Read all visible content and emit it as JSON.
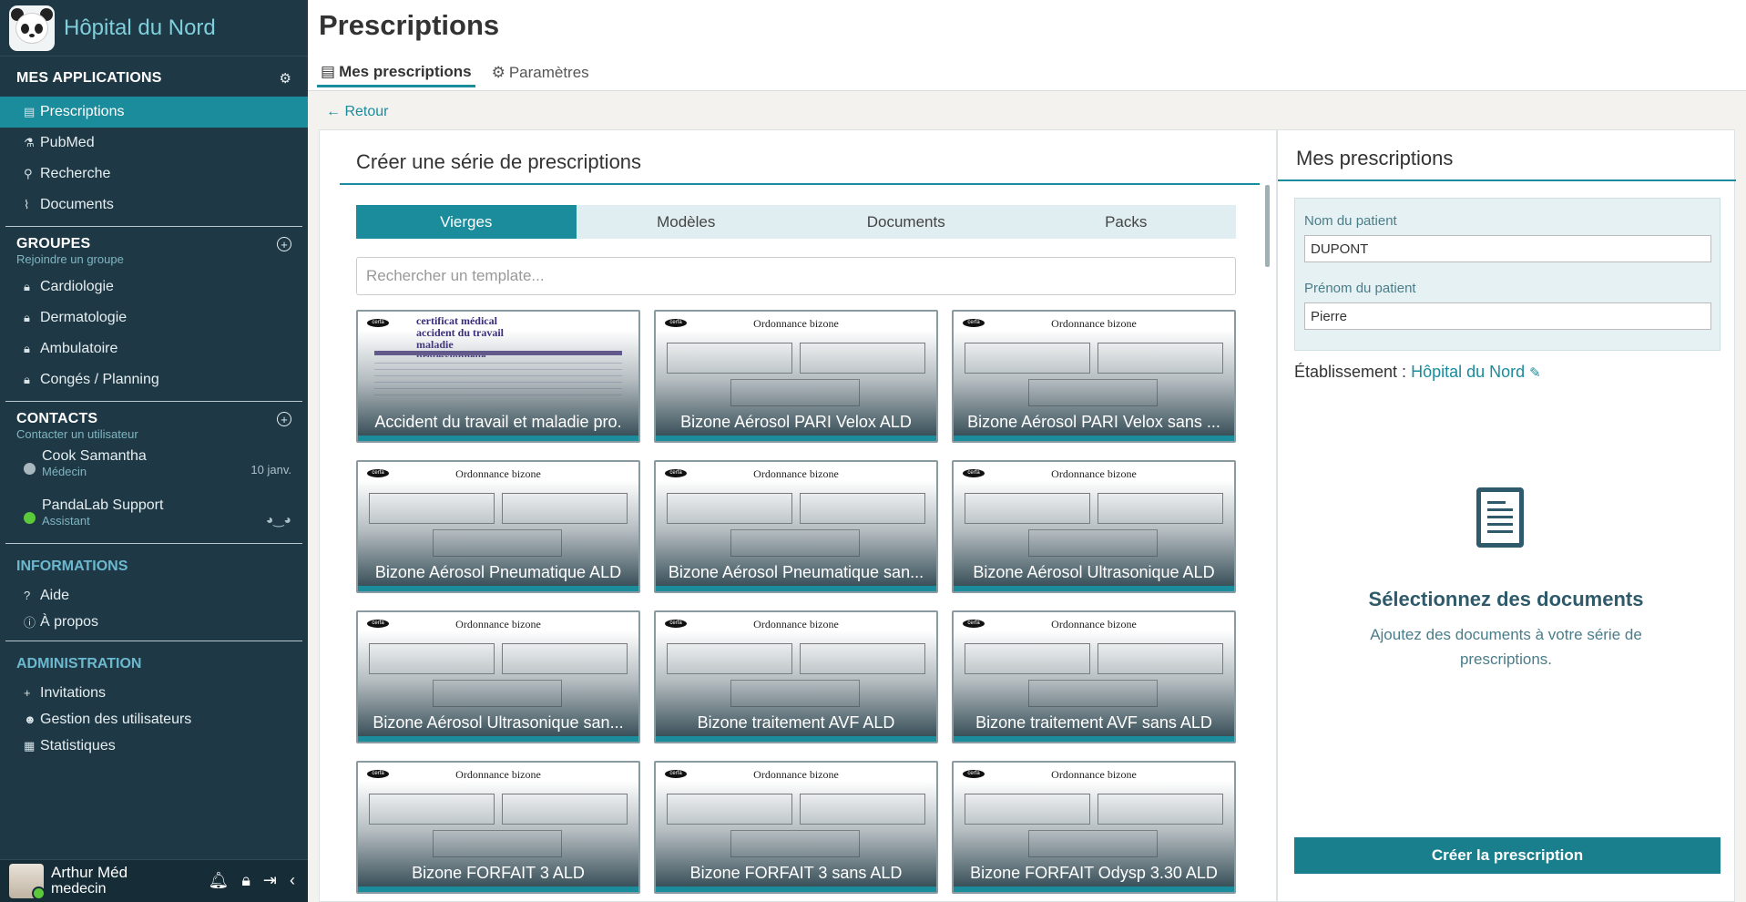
{
  "brand": {
    "title": "Hôpital du Nord"
  },
  "apps": {
    "title": "MES APPLICATIONS",
    "items": [
      {
        "label": "Prescriptions",
        "icon": "prescription-icon"
      },
      {
        "label": "PubMed",
        "icon": "pubmed-icon"
      },
      {
        "label": "Recherche",
        "icon": "search-icon"
      },
      {
        "label": "Documents",
        "icon": "paperclip-icon"
      }
    ]
  },
  "groups": {
    "title": "GROUPES",
    "subtitle": "Rejoindre un groupe",
    "items": [
      "Cardiologie",
      "Dermatologie",
      "Ambulatoire",
      "Congés / Planning"
    ]
  },
  "contacts": {
    "title": "CONTACTS",
    "subtitle": "Contacter un utilisateur",
    "items": [
      {
        "name": "Cook Samantha",
        "role": "Médecin",
        "date": "10 janv.",
        "status_color": "#a9b8be"
      },
      {
        "name": "PandaLab Support",
        "role": "Assistant",
        "status_color": "#5cc93b"
      }
    ]
  },
  "info": {
    "title": "INFORMATIONS",
    "items": [
      "Aide",
      "À propos"
    ]
  },
  "admin": {
    "title": "ADMINISTRATION",
    "items": [
      "Invitations",
      "Gestion des utilisateurs",
      "Statistiques"
    ]
  },
  "user": {
    "name": "Arthur Méd",
    "role": "medecin"
  },
  "header": {
    "title": "Prescriptions",
    "tabs": [
      "Mes prescriptions",
      "Paramètres"
    ]
  },
  "back_label": "Retour",
  "create_panel": {
    "title": "Créer une série de prescriptions",
    "segments": [
      "Vierges",
      "Modèles",
      "Documents",
      "Packs"
    ],
    "search_placeholder": "Rechercher un template...",
    "templates": [
      "Accident du travail et maladie pro.",
      "Bizone Aérosol PARI Velox ALD",
      "Bizone Aérosol PARI Velox sans ...",
      "Bizone Aérosol Pneumatique ALD",
      "Bizone Aérosol Pneumatique san...",
      "Bizone Aérosol Ultrasonique ALD",
      "Bizone Aérosol Ultrasonique san...",
      "Bizone traitement AVF ALD",
      "Bizone traitement AVF sans ALD",
      "Bizone FORFAIT 3 ALD",
      "Bizone FORFAIT 3 sans ALD",
      "Bizone FORFAIT Odysp 3.30 ALD"
    ],
    "doc_title": "Ordonnance bizone",
    "doc_badge": "cerfa",
    "accident_title": "certificat médical accident du travail maladie professionnelle"
  },
  "my_panel": {
    "title": "Mes prescriptions",
    "last_name_label": "Nom du patient",
    "last_name": "DUPONT",
    "first_name_label": "Prénom du patient",
    "first_name": "Pierre",
    "etab_label": "Établissement :",
    "etab_value": "Hôpital du Nord",
    "empty_title": "Sélectionnez des documents",
    "empty_text": "Ajoutez des documents à votre série de prescriptions.",
    "create_label": "Créer la prescription"
  },
  "colors": {
    "accent": "#1a8c9c",
    "sidebar": "#1e3945"
  }
}
